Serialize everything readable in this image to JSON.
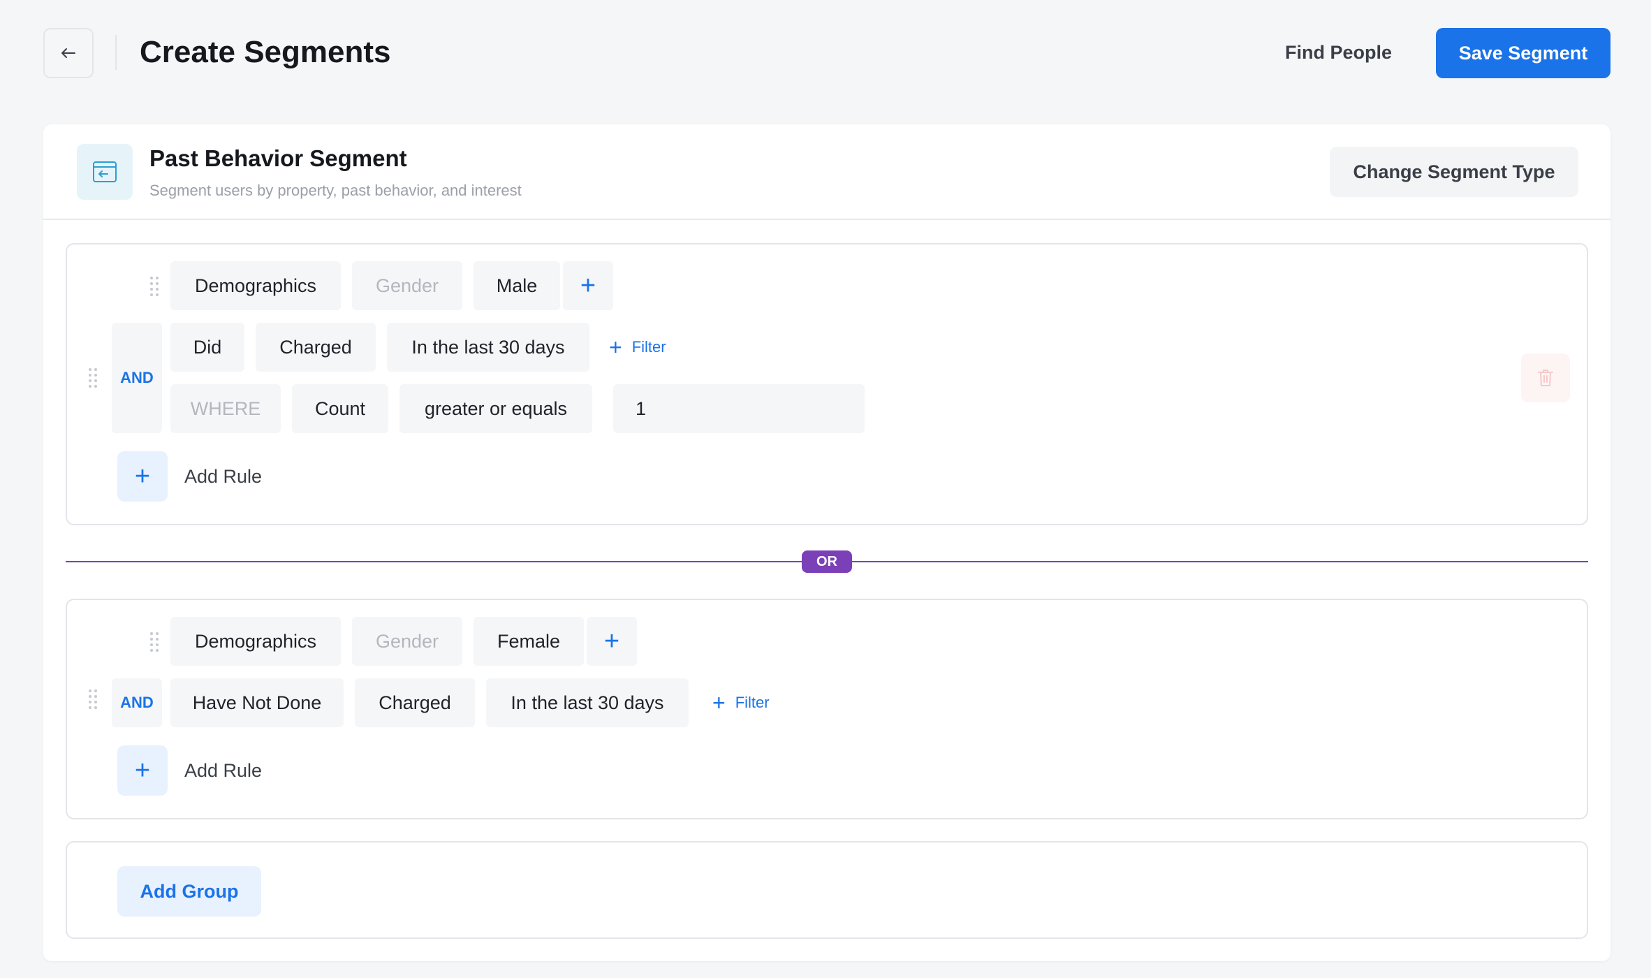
{
  "header": {
    "back_icon": "arrow-left-icon",
    "title": "Create Segments",
    "find_people": "Find People",
    "save_segment": "Save Segment"
  },
  "segment": {
    "icon": "segment-window-icon",
    "title": "Past Behavior Segment",
    "subtitle": "Segment users by property, past behavior, and interest",
    "change_type": "Change Segment Type"
  },
  "groups": [
    {
      "property": {
        "category": "Demographics",
        "field": "Gender",
        "value": "Male"
      },
      "connector": "AND",
      "behavior": {
        "action": "Did",
        "event": "Charged",
        "time": "In the last 30 days",
        "filter": "Filter"
      },
      "where": {
        "label": "WHERE",
        "metric": "Count",
        "operator": "greater or equals",
        "value": "1"
      },
      "add_rule": "Add Rule"
    },
    {
      "property": {
        "category": "Demographics",
        "field": "Gender",
        "value": "Female"
      },
      "connector": "AND",
      "behavior": {
        "action": "Have Not Done",
        "event": "Charged",
        "time": "In the last 30 days",
        "filter": "Filter"
      },
      "add_rule": "Add Rule"
    }
  ],
  "or_label": "OR",
  "add_group": "Add Group",
  "colors": {
    "accent": "#1a73e8",
    "or_purple": "#7b3fb8",
    "danger_light": "#f7c9c9"
  }
}
